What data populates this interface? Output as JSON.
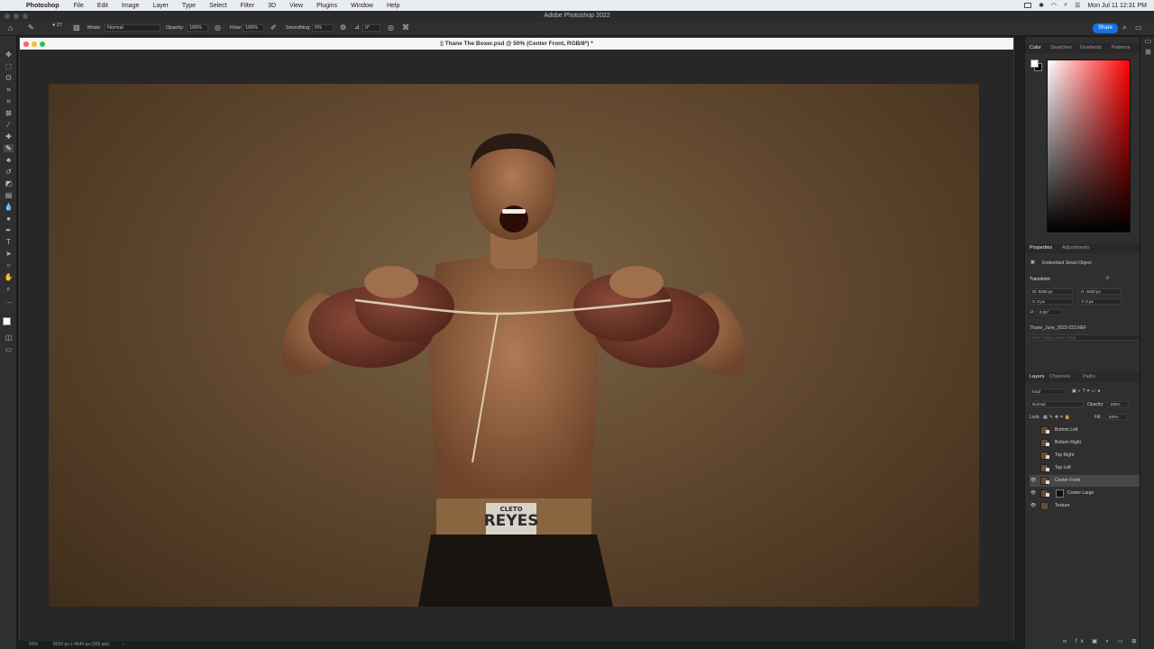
{
  "menubar": {
    "app": "Photoshop",
    "items": [
      "File",
      "Edit",
      "Image",
      "Layer",
      "Type",
      "Select",
      "Filter",
      "3D",
      "View",
      "Plugins",
      "Window",
      "Help"
    ],
    "clock": "Mon Jul 11  12:31 PM"
  },
  "app_title": "Adobe Photoshop 2022",
  "options": {
    "brush_size": "27",
    "mode_label": "Mode:",
    "mode_value": "Normal",
    "opacity_label": "Opacity:",
    "opacity_value": "100%",
    "flow_label": "Flow:",
    "flow_value": "100%",
    "smoothing_label": "Smoothing:",
    "smoothing_value": "0%",
    "angle_value": "0°",
    "share_label": "Share"
  },
  "document": {
    "title": "Thane The Boxer.psd @ 50% (Center Front, RGB/8*) *",
    "zoom": "50%",
    "dimensions": "8256 px x 4640 px (300 ppi)",
    "trunks_text": "REYES",
    "trunks_small": "CLETO"
  },
  "color_panel": {
    "tabs": [
      "Color",
      "Swatches",
      "Gradients",
      "Patterns"
    ],
    "foreground": "#ffffff",
    "background": "#000000"
  },
  "properties_panel": {
    "tabs": [
      "Properties",
      "Adjustments"
    ],
    "object_type": "Embedded Smart Object",
    "section": "Transform",
    "w": "W: 8256 px",
    "h": "H: 4640 px",
    "x": "X: 0 px",
    "y": "Y: 0 px",
    "angle": "0.00°",
    "filename": "Thane_June_2022-023.NEF",
    "layer_comp": "Don't Apply Layer Comp"
  },
  "layers_panel": {
    "tabs": [
      "Layers",
      "Channels",
      "Paths"
    ],
    "filter": "Kind",
    "blend_mode": "Normal",
    "opacity_label": "Opacity:",
    "opacity_value": "100%",
    "lock_label": "Lock:",
    "fill_label": "Fill:",
    "fill_value": "100%",
    "layers": [
      {
        "name": "Bottom Left",
        "visible": false,
        "selected": false
      },
      {
        "name": "Bottom Right",
        "visible": false,
        "selected": false
      },
      {
        "name": "Top Right",
        "visible": false,
        "selected": false
      },
      {
        "name": "Top Left",
        "visible": false,
        "selected": false
      },
      {
        "name": "Center Front",
        "visible": true,
        "selected": true
      },
      {
        "name": "Center Large",
        "visible": true,
        "selected": false
      },
      {
        "name": "Texture",
        "visible": true,
        "selected": false
      }
    ]
  }
}
